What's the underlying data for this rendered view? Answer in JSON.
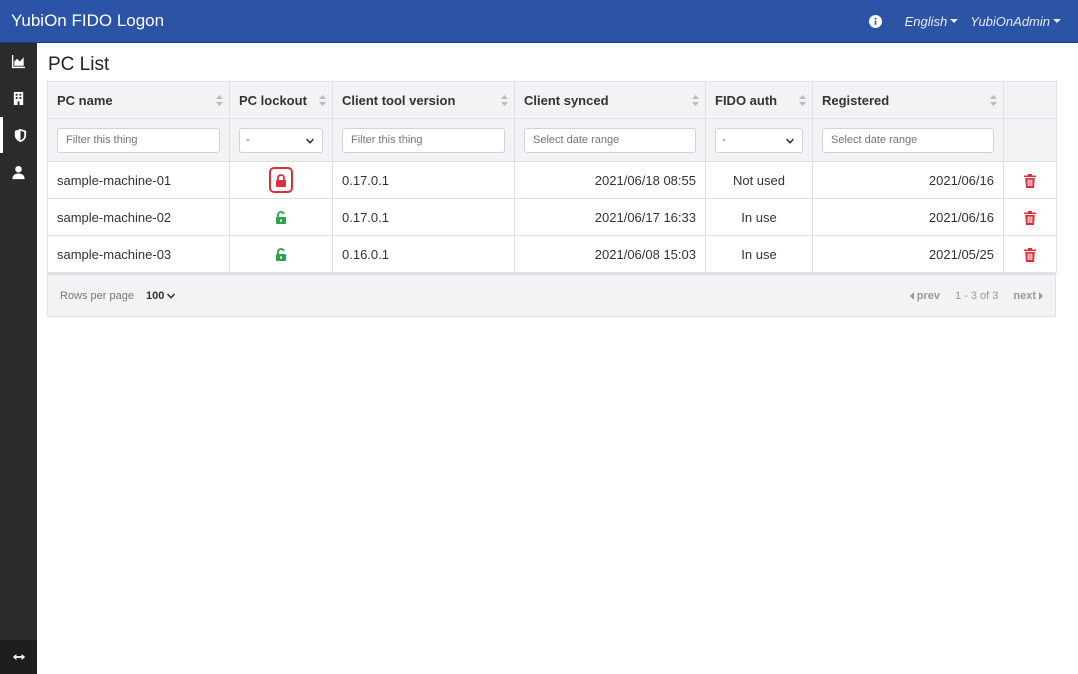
{
  "app": {
    "title": "YubiOn FIDO Logon"
  },
  "topbar": {
    "language": "English",
    "user": "YubiOnAdmin"
  },
  "icons": {
    "info": "info-icon",
    "chart": "area-chart-icon",
    "building": "building-icon",
    "shield": "shield-icon",
    "user": "user-icon",
    "expand": "expand-arrows-icon",
    "locked": "lock-icon",
    "unlocked": "unlock-icon",
    "delete": "trash-icon"
  },
  "colors": {
    "header": "#2b53a6",
    "sidebar": "#2b2b2b",
    "locked": "#d9303d",
    "unlocked": "#2e9e4f",
    "delete": "#d9303d"
  },
  "page": {
    "title": "PC List"
  },
  "table": {
    "columns": [
      "PC name",
      "PC lockout",
      "Client tool version",
      "Client synced",
      "FIDO auth",
      "Registered"
    ],
    "filters": {
      "pc_name_placeholder": "Filter this thing",
      "lockout_selected": "-",
      "version_placeholder": "Filter this thing",
      "synced_placeholder": "Select date range",
      "fido_selected": "-",
      "registered_placeholder": "Select date range"
    },
    "rows": [
      {
        "pc_name": "sample-machine-01",
        "locked": true,
        "version": "0.17.0.1",
        "synced": "2021/06/18 08:55",
        "fido": "Not used",
        "registered": "2021/06/16"
      },
      {
        "pc_name": "sample-machine-02",
        "locked": false,
        "version": "0.17.0.1",
        "synced": "2021/06/17 16:33",
        "fido": "In use",
        "registered": "2021/06/16"
      },
      {
        "pc_name": "sample-machine-03",
        "locked": false,
        "version": "0.16.0.1",
        "synced": "2021/06/08 15:03",
        "fido": "In use",
        "registered": "2021/05/25"
      }
    ]
  },
  "footer": {
    "rows_per_page_label": "Rows per page",
    "rows_per_page": "100",
    "prev": "prev",
    "range": "1 - 3 of 3",
    "next": "next"
  }
}
